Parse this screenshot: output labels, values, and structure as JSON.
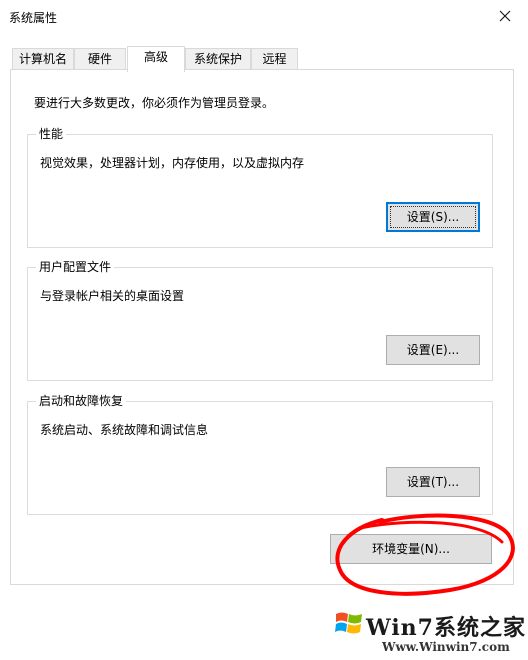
{
  "window": {
    "title": "系统属性",
    "close_icon": "close-icon"
  },
  "tabs": [
    {
      "label": "计算机名",
      "active": false
    },
    {
      "label": "硬件",
      "active": false
    },
    {
      "label": "高级",
      "active": true
    },
    {
      "label": "系统保护",
      "active": false
    },
    {
      "label": "远程",
      "active": false
    }
  ],
  "advanced": {
    "admin_note": "要进行大多数更改，你必须作为管理员登录。",
    "performance": {
      "title": "性能",
      "description": "视觉效果，处理器计划，内存使用，以及虚拟内存",
      "button": "设置(S)..."
    },
    "user_profiles": {
      "title": "用户配置文件",
      "description": "与登录帐户相关的桌面设置",
      "button": "设置(E)..."
    },
    "startup_recovery": {
      "title": "启动和故障恢复",
      "description": "系统启动、系统故障和调试信息",
      "button": "设置(T)..."
    },
    "env_button": "环境变量(N)..."
  },
  "annotation": {
    "color": "#ff0000",
    "shape": "hand-drawn circle around env_button"
  },
  "watermark": {
    "text": "Win7系统之家",
    "sub": "Www.Winwin7.com",
    "logo": "windows-flag-icon"
  },
  "colors": {
    "focus": "#0078d7",
    "button_bg": "#e1e1e1",
    "tab_bg": "#f0f0f0"
  }
}
